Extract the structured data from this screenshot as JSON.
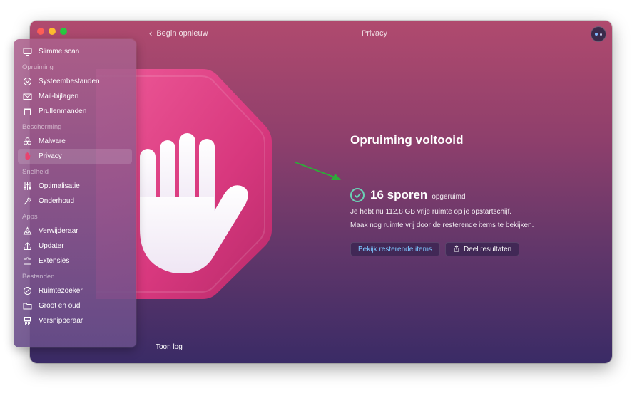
{
  "window": {
    "title": "Privacy",
    "back_label": "Begin opnieuw",
    "show_log_label": "Toon log"
  },
  "sidebar": {
    "top_item": {
      "label": "Slimme scan",
      "icon": "monitor-icon"
    },
    "sections": [
      {
        "title": "Opruiming",
        "items": [
          {
            "label": "Systeembestanden",
            "icon": "system-junk-icon"
          },
          {
            "label": "Mail-bijlagen",
            "icon": "mail-icon"
          },
          {
            "label": "Prullenmanden",
            "icon": "trash-icon"
          }
        ]
      },
      {
        "title": "Bescherming",
        "items": [
          {
            "label": "Malware",
            "icon": "biohazard-icon"
          },
          {
            "label": "Privacy",
            "icon": "hand-icon"
          }
        ]
      },
      {
        "title": "Snelheid",
        "items": [
          {
            "label": "Optimalisatie",
            "icon": "sliders-icon"
          },
          {
            "label": "Onderhoud",
            "icon": "wrench-icon"
          }
        ]
      },
      {
        "title": "Apps",
        "items": [
          {
            "label": "Verwijderaar",
            "icon": "uninstaller-icon"
          },
          {
            "label": "Updater",
            "icon": "updater-icon"
          },
          {
            "label": "Extensies",
            "icon": "extensions-icon"
          }
        ]
      },
      {
        "title": "Bestanden",
        "items": [
          {
            "label": "Ruimtezoeker",
            "icon": "space-lens-icon"
          },
          {
            "label": "Groot en oud",
            "icon": "folder-icon"
          },
          {
            "label": "Versnipperaar",
            "icon": "shredder-icon"
          }
        ]
      }
    ]
  },
  "result": {
    "heading": "Opruiming voltooid",
    "count": "16 sporen",
    "count_suffix": "opgeruimd",
    "line1": "Je hebt nu 112,8 GB vrije ruimte op je opstartschijf.",
    "line2": "Maak nog ruimte vrij door de resterende items te bekijken.",
    "primary_button": "Bekijk resterende items",
    "secondary_button": "Deel resultaten"
  },
  "colors": {
    "accent_link": "#7cc6ff",
    "check": "#6ad0b4",
    "stop_sign": "#e2448a",
    "arrow": "#2faa3a"
  }
}
